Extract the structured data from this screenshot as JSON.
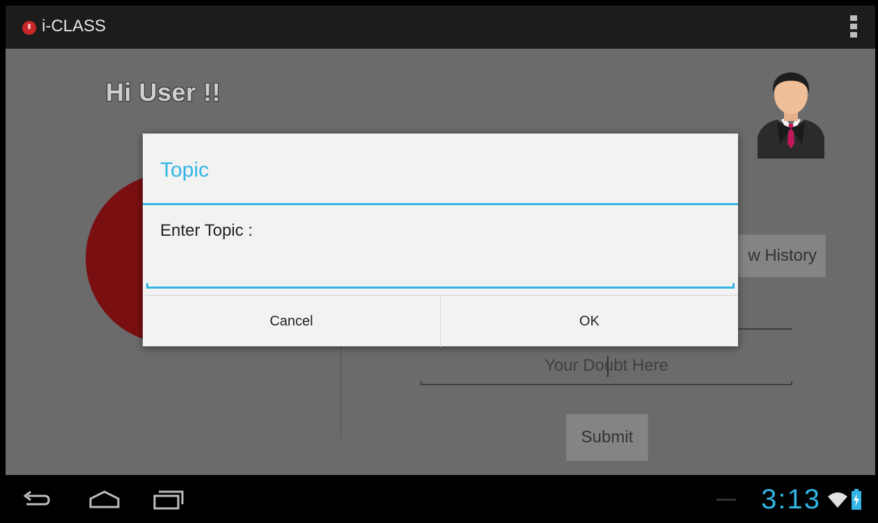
{
  "app": {
    "title": "i-CLASS"
  },
  "main": {
    "greeting": "Hi User !!",
    "history_button": "w History",
    "doubt_placeholder": "Your Doubt Here",
    "submit_label": "Submit"
  },
  "dialog": {
    "title": "Topic",
    "message": "Enter Topic :",
    "input_value": "",
    "cancel_label": "Cancel",
    "ok_label": "OK"
  },
  "status_bar": {
    "time": "3:13"
  },
  "colors": {
    "accent": "#33b5e5",
    "record": "#7a0f12",
    "background": "#6b6b6b"
  },
  "icons": [
    "record-icon",
    "overflow-menu-icon",
    "user-avatar-icon",
    "back-icon",
    "home-icon",
    "recent-apps-icon",
    "wifi-icon",
    "battery-charging-icon"
  ]
}
